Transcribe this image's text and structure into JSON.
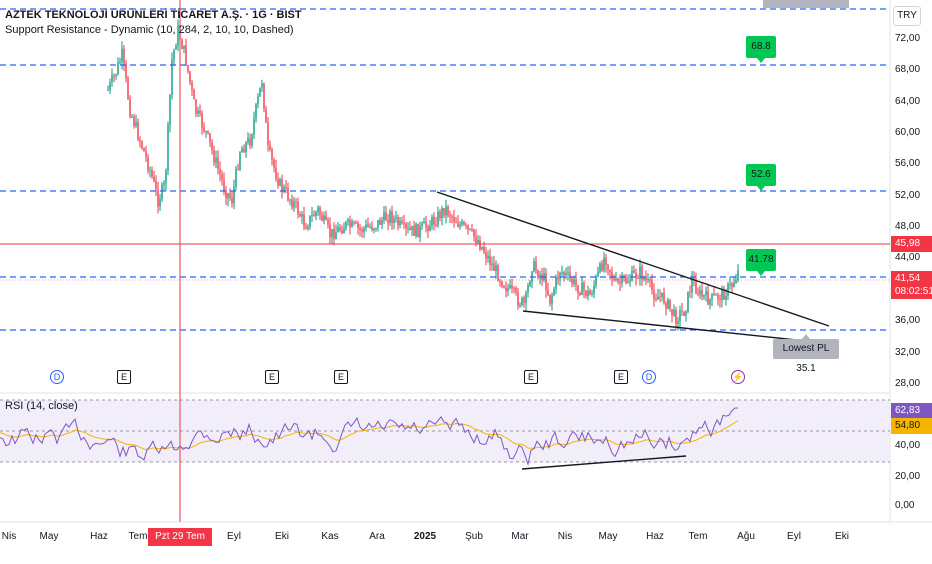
{
  "header": {
    "title": "AZTEK TEKNOLOJİ ÜRÜNLERİ TİCARET A.Ş. · 1G · BIST",
    "indicator": "Support Resistance - Dynamic (10, 284, 2, 10, 10, Dashed)",
    "currency": "TRY"
  },
  "rsi": {
    "title": "RSI (14, close)",
    "value_label": "62,83",
    "ma_label": "54,80",
    "colors": {
      "line": "#7e57c2",
      "ma": "#f5b400",
      "band": "#ede7f6"
    }
  },
  "price_axis": [
    "72,00",
    "68,00",
    "64,00",
    "60,00",
    "56,00",
    "52,00",
    "48,00",
    "44,00",
    "40,00",
    "36,00",
    "32,00",
    "28,00"
  ],
  "rsi_axis": [
    "60,00",
    "40,00",
    "20,00",
    "0,00"
  ],
  "time_axis": [
    "Nis",
    "May",
    "Haz",
    "Tem",
    "Pzt 29 Tem '24",
    "Eyl",
    "Eki",
    "Kas",
    "Ara",
    "2025",
    "Şub",
    "Mar",
    "Nis",
    "May",
    "Haz",
    "Tem",
    "Ağu",
    "Eyl",
    "Eki"
  ],
  "price_tags": {
    "crosshair_price": "45,98",
    "last_price": "41,54",
    "countdown": "08:02:51",
    "colors": {
      "crosshair": "#f23645",
      "last": "#f23645"
    }
  },
  "levels": {
    "flags": [
      "68.8",
      "52.6",
      "41.78"
    ],
    "lowest": "Lowest PL 35.1",
    "color": "#2962ff"
  },
  "events": [
    {
      "icon": "dividend-icon",
      "glyph": "D"
    },
    {
      "icon": "earnings-icon",
      "glyph": "E"
    },
    {
      "icon": "earnings-icon",
      "glyph": "E"
    },
    {
      "icon": "earnings-icon",
      "glyph": "E"
    },
    {
      "icon": "earnings-icon",
      "glyph": "E"
    },
    {
      "icon": "earnings-icon",
      "glyph": "E"
    },
    {
      "icon": "dividend-icon",
      "glyph": "D"
    },
    {
      "icon": "split-icon",
      "glyph": "⚡"
    }
  ],
  "candle_colors": {
    "up": "#089981",
    "down": "#f23645"
  }
}
